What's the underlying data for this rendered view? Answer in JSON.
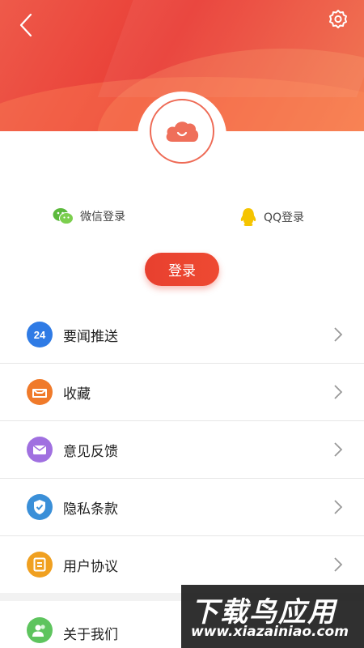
{
  "header": {
    "back_icon": "chevron-left-icon",
    "settings_icon": "gear-icon"
  },
  "avatar": {
    "icon": "cloud-smile-icon"
  },
  "social": {
    "wechat_label": "微信登录",
    "qq_label": "QQ登录"
  },
  "login_label": "登录",
  "menu": [
    {
      "label": "要闻推送",
      "icon": "24-news-icon",
      "color": "#2f7be5"
    },
    {
      "label": "收藏",
      "icon": "collection-box-icon",
      "color": "#f07a2a"
    },
    {
      "label": "意见反馈",
      "icon": "mail-icon",
      "color": "#a070e0"
    },
    {
      "label": "隐私条款",
      "icon": "shield-check-icon",
      "color": "#3a8fd8"
    },
    {
      "label": "用户协议",
      "icon": "document-icon",
      "color": "#f0a020"
    }
  ],
  "about": {
    "label": "关于我们",
    "icon": "people-icon",
    "color": "#5ec45e"
  },
  "watermark": {
    "title": "下载鸟应用",
    "url": "www.xiazainiao.com"
  }
}
